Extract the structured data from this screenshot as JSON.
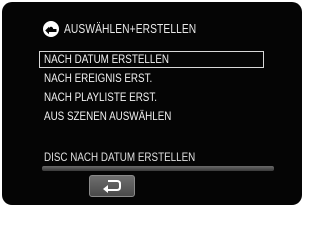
{
  "header": {
    "title": "AUSWÄHLEN+ERSTELLEN",
    "icon": "disc-create-icon"
  },
  "menu": {
    "items": [
      {
        "label": "NACH DATUM ERSTELLEN",
        "selected": true
      },
      {
        "label": "NACH EREIGNIS ERST.",
        "selected": false
      },
      {
        "label": "NACH PLAYLISTE ERST.",
        "selected": false
      },
      {
        "label": "AUS SZENEN AUSWÄHLEN",
        "selected": false
      }
    ],
    "description": "DISC NACH DATUM ERSTELLEN"
  },
  "footer": {
    "back_icon": "back-return-icon"
  },
  "colors": {
    "background": "#050505",
    "text": "#f2f2f2",
    "button": "#5a5a5a"
  }
}
